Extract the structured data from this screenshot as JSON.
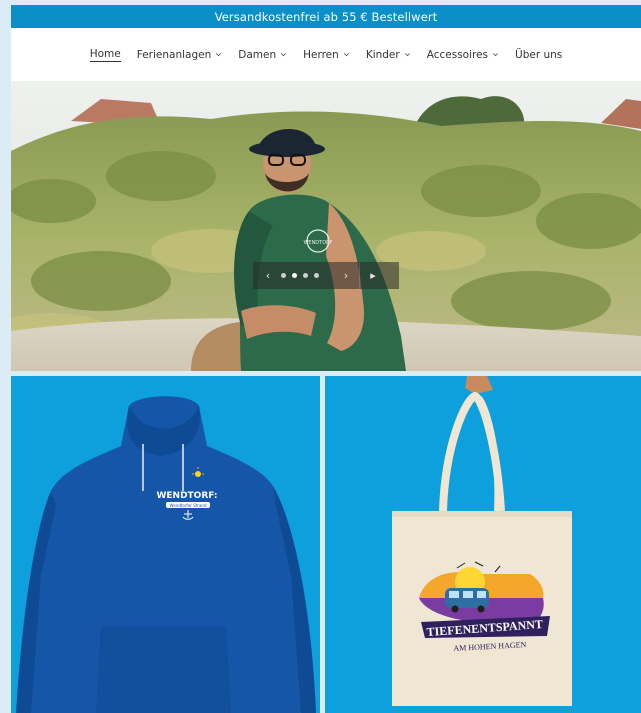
{
  "announcement": "Versandkostenfrei ab 55 € Bestellwert",
  "nav": {
    "items": [
      {
        "label": "Home",
        "active": true,
        "dropdown": false
      },
      {
        "label": "Ferienanlagen",
        "active": false,
        "dropdown": true
      },
      {
        "label": "Damen",
        "active": false,
        "dropdown": true
      },
      {
        "label": "Herren",
        "active": false,
        "dropdown": true
      },
      {
        "label": "Kinder",
        "active": false,
        "dropdown": true
      },
      {
        "label": "Accessoires",
        "active": false,
        "dropdown": true
      },
      {
        "label": "Über uns",
        "active": false,
        "dropdown": false
      }
    ]
  },
  "slider": {
    "prev_icon": "‹",
    "next_icon": "›",
    "play_icon": "▸",
    "dot_count": 4,
    "active_dot": 1,
    "shirt_logo": "WENDTORF"
  },
  "products": {
    "hoodie": {
      "print_title": "WENDTORF:",
      "print_subtitle": "Wendtorfer Strand"
    },
    "bag": {
      "print_title": "TIEFENENTSPANNT",
      "print_subtitle": "AM HOHEN HAGEN"
    }
  },
  "colors": {
    "accent": "#0a8fc7",
    "product_bg": "#0ea0dc",
    "hoodie": "#1556a8",
    "bag": "#efe7d4"
  }
}
